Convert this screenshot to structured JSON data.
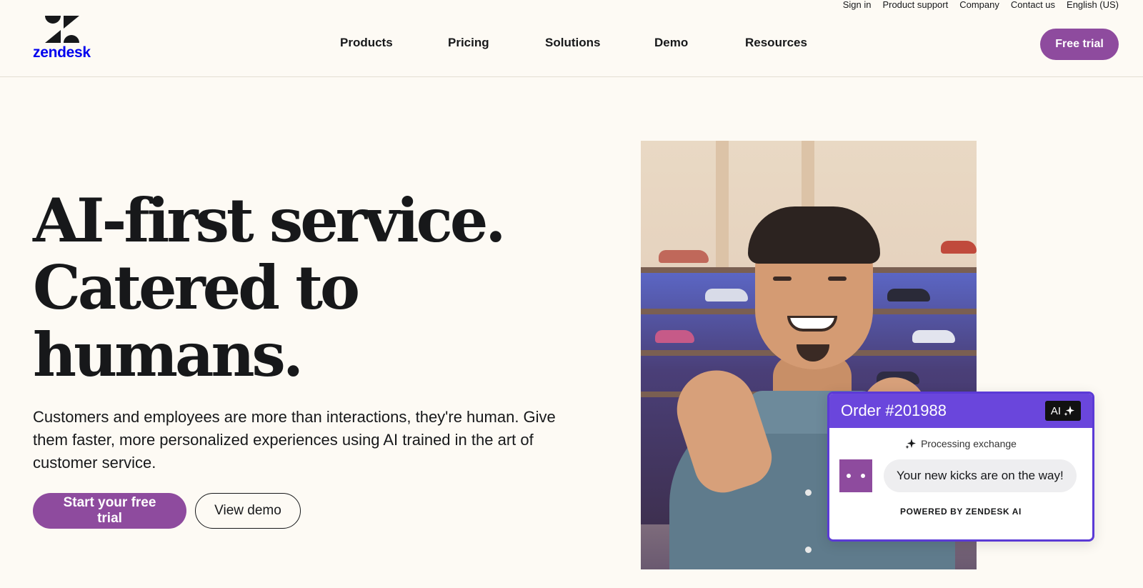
{
  "utility_nav": [
    "Sign in",
    "Product support",
    "Company",
    "Contact us",
    "English (US)"
  ],
  "brand": {
    "name": "zendesk"
  },
  "main_nav": [
    "Products",
    "Pricing",
    "Solutions",
    "Demo",
    "Resources"
  ],
  "header": {
    "cta_label": "Free trial"
  },
  "hero": {
    "title_lines": [
      "AI-first service.",
      "Catered to",
      "humans."
    ],
    "subtitle": "Customers and employees are more than interactions, they're human. Give them faster, more personalized experiences using AI trained in the art of customer service.",
    "primary_cta": "Start your free trial",
    "secondary_cta": "View demo"
  },
  "order_card": {
    "title": "Order #201988",
    "badge": "AI",
    "status": "Processing exchange",
    "message": "Your new kicks are on the way!",
    "footer": "POWERED BY ZENDESK AI"
  },
  "colors": {
    "accent": "#8e4b9e",
    "card_border": "#5b3ad6",
    "card_header": "#6a46dc",
    "background": "#fdfaf4"
  }
}
